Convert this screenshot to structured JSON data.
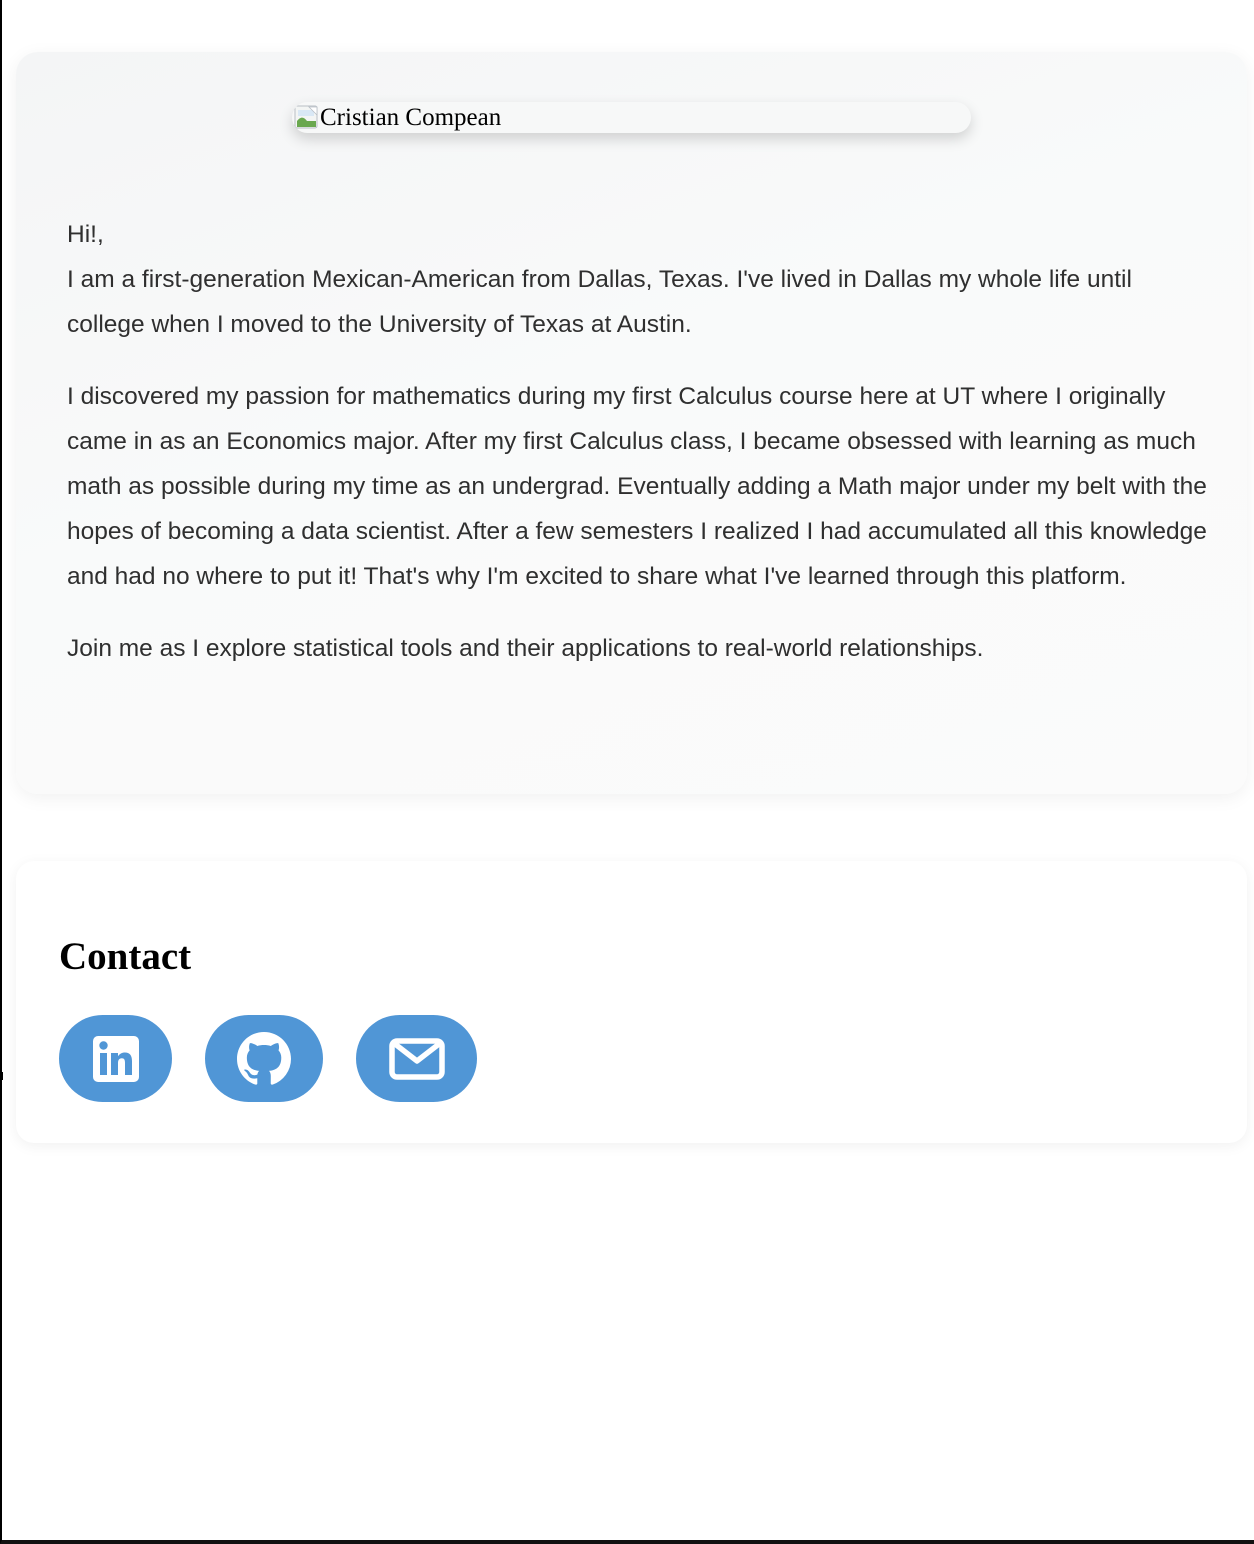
{
  "profile": {
    "image_alt": "Cristian Compean"
  },
  "about": {
    "greeting": "Hi!,",
    "intro": "I am a first-generation Mexican-American from Dallas, Texas. I've lived in Dallas my whole life until college when I moved to the University of Texas at Austin.",
    "paragraph_2": "I discovered my passion for mathematics during my first Calculus course here at UT where I originally came in as an Economics major. After my first Calculus class, I became obsessed with learning as much math as possible during my time as an undergrad. Eventually adding a Math major under my belt with the hopes of becoming a data scientist. After a few semesters I realized I had accumulated all this knowledge and had no where to put it! That's why I'm excited to share what I've learned through this platform.",
    "paragraph_3": "Join me as I explore statistical tools and their applications to real-world relationships."
  },
  "contact": {
    "heading": "Contact",
    "buttons": [
      {
        "icon": "linkedin-icon",
        "color": "#5096d6"
      },
      {
        "icon": "github-icon",
        "color": "#5096d6"
      },
      {
        "icon": "email-icon",
        "color": "#5096d6"
      }
    ]
  },
  "colors": {
    "accent": "#5096d6",
    "body_text": "#2f2f2f",
    "card_background": "#f8f9f9"
  }
}
